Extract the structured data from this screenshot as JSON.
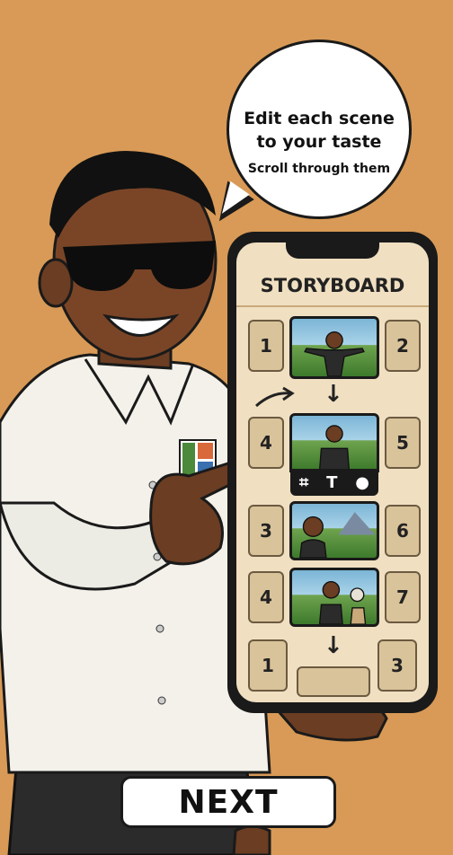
{
  "bubble": {
    "line1": "Edit each scene",
    "line2": "to your taste",
    "line3": "Scroll through them"
  },
  "phone": {
    "title": "STORYBOARD",
    "tiles": {
      "r1_left": "1",
      "r1_right": "2",
      "r2_left": "4",
      "r2_right": "5",
      "r3_left": "3",
      "r3_right": "6",
      "r4_left": "4",
      "r4_right": "7",
      "r5_left": "1",
      "r5_right": "3"
    },
    "toolbar": {
      "crop_glyph": "⌗",
      "text_glyph": "T",
      "person_glyph": "●"
    },
    "arrow_glyph": "↓"
  },
  "next_button": {
    "label": "NEXT"
  },
  "colors": {
    "background": "#d89a56",
    "screen": "#f0dfc1",
    "tile": "#d9c39a"
  }
}
